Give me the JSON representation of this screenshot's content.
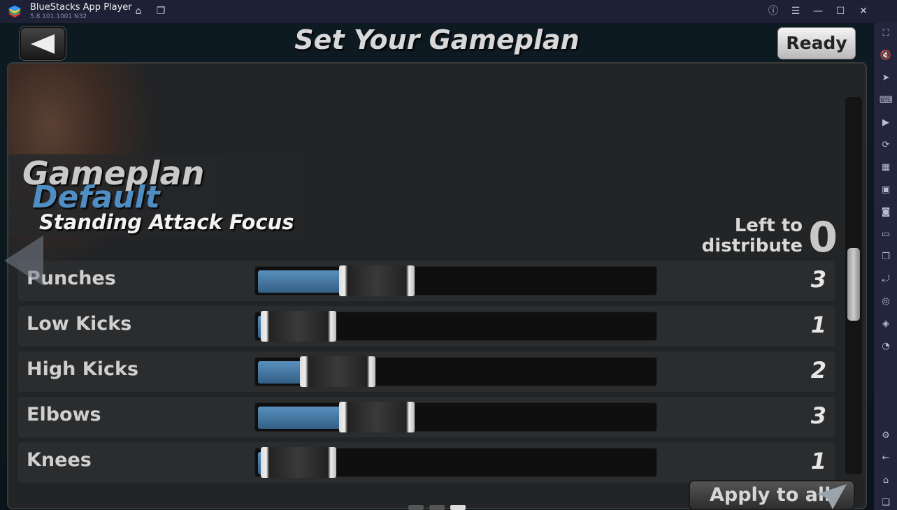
{
  "titlebar": {
    "app_name": "BlueStacks App Player",
    "version": "5.8.101.1001 N32",
    "icons": [
      "home-icon",
      "multi-instance-icon",
      "help-icon",
      "menu-icon",
      "minimize-icon",
      "maximize-icon",
      "close-icon"
    ]
  },
  "game": {
    "title": "Set Your Gameplan",
    "ready_label": "Ready",
    "gameplan_label": "Gameplan",
    "gameplan_name": "Default",
    "gameplan_focus": "Standing Attack Focus",
    "left_to_distribute_label": "Left to distribute",
    "left_to_distribute_line1": "Left to",
    "left_to_distribute_line2": "distribute",
    "left_to_distribute_value": "0",
    "sliders": [
      {
        "label": "Punches",
        "value": 3
      },
      {
        "label": "Low Kicks",
        "value": 1
      },
      {
        "label": "High Kicks",
        "value": 2
      },
      {
        "label": "Elbows",
        "value": 3
      },
      {
        "label": "Knees",
        "value": 1
      }
    ],
    "pager": {
      "pages": 3,
      "active": 3
    },
    "apply_label": "Apply to all",
    "accent_color": "#4f8dc2"
  },
  "sidebar": {
    "icons": [
      "fullscreen-icon",
      "volume-mute-icon",
      "pointer-icon",
      "keyboard-icon",
      "macro-record-icon",
      "sync-icon",
      "performance-icon",
      "apk-install-icon",
      "screenshot-icon",
      "folder-icon",
      "multi-instance-icon",
      "rotate-icon",
      "location-icon",
      "layers-icon",
      "speed-icon",
      "settings-icon",
      "back-icon",
      "home-icon",
      "recent-apps-icon"
    ]
  }
}
